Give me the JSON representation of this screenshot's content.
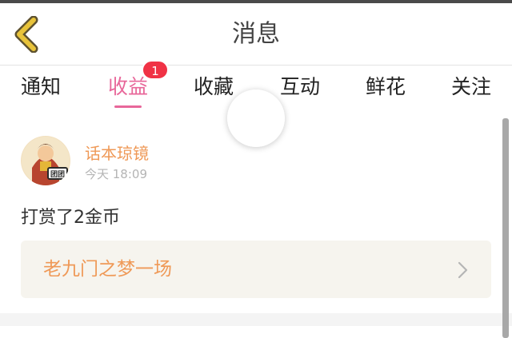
{
  "header": {
    "title": "消息",
    "back_icon": "chevron-left-icon"
  },
  "tabs": [
    {
      "label": "通知",
      "active": false
    },
    {
      "label": "收益",
      "active": true,
      "badge": "1"
    },
    {
      "label": "收藏",
      "active": false
    },
    {
      "label": "互动",
      "active": false
    },
    {
      "label": "鲜花",
      "active": false
    },
    {
      "label": "关注",
      "active": false
    }
  ],
  "item": {
    "username": "话本琼镜",
    "time": "今天 18:09",
    "message": "打赏了2金币",
    "work_title": "老九门之梦一场",
    "avatar_label": "团团"
  },
  "colors": {
    "accent": "#e8679a",
    "username": "#ef9957",
    "badge": "#f03245",
    "back_icon": "#e8c33a"
  }
}
